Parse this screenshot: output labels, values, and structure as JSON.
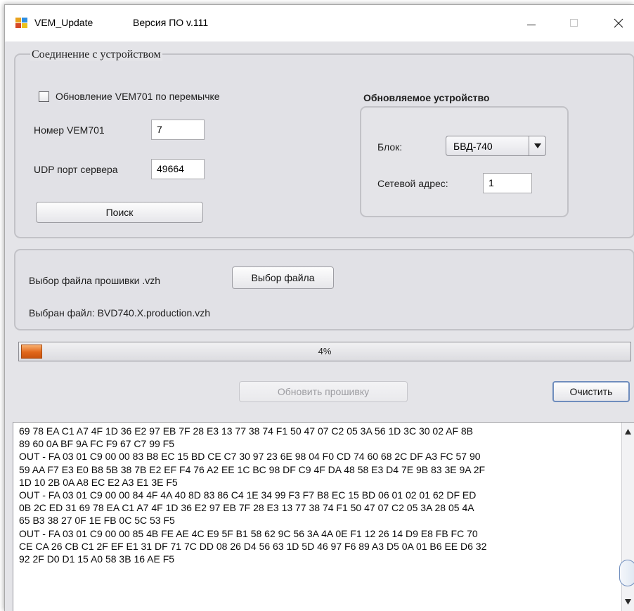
{
  "window": {
    "app_name": "VEM_Update",
    "version_label": "Версия ПО v.111",
    "icon_colors": [
      "#e8a21d",
      "#2f8ee0",
      "#d64826",
      "#ecc21e"
    ]
  },
  "connection": {
    "group_title": "Соединение с устройством",
    "jumper_update_label": "Обновление VEM701 по перемычке",
    "jumper_update_checked": false,
    "vem_number_label": "Номер VEM701",
    "vem_number_value": "7",
    "udp_port_label": "UDP порт сервера",
    "udp_port_value": "49664",
    "search_button": "Поиск"
  },
  "device": {
    "group_title": "Обновляемое устройство",
    "block_label": "Блок:",
    "block_value": "БВД-740",
    "network_address_label": "Сетевой адрес:",
    "network_address_value": "1"
  },
  "firmware": {
    "select_label": "Выбор файла прошивки .vzh",
    "select_button": "Выбор файла",
    "selected_text": "Выбран файл: BVD740.X.production.vzh"
  },
  "progress": {
    "value_percent": 4,
    "text": "4%",
    "fill_color": "#e2671a"
  },
  "actions": {
    "update_button": "Обновить прошивку",
    "update_enabled": false,
    "clear_button": "Очистить"
  },
  "log": {
    "text": "69 78 EA C1 A7 4F 1D 36 E2 97 EB 7F 28 E3 13 77 38 74 F1 50 47 07 C2 05 3A 56 1D 3C 30 02 AF 8B\n89 60 0A BF 9A FC F9 67 C7 99 F5\nOUT - FA 03 01 C9 00 00 83 B8 EC 15 BD CE C7 30 97 23 6E 98 04 F0 CD 74 60 68 2C DF A3 FC 57 90\n59 AA F7 E3 E0 B8 5B 38 7B E2 EF F4 76 A2 EE 1C BC 98 DF C9 4F DA 48 58 E3 D4 7E 9B 83 3E 9A 2F\n1D 10 2B 0A A8 EC E2 A3 E1 3E F5\nOUT - FA 03 01 C9 00 00 84 4F 4A 40 8D 83 86 C4 1E 34 99 F3 F7 B8 EC 15 BD 06 01 02 01 62 DF ED\n0B 2C ED 31 69 78 EA C1 A7 4F 1D 36 E2 97 EB 7F 28 E3 13 77 38 74 F1 50 47 07 C2 05 3A 28 05 4A\n65 B3 38 27 0F 1E FB 0C 5C 53 F5\nOUT - FA 03 01 C9 00 00 85 4B FE AE 4C E9 5F B1 58 62 9C 56 3A 4A 0E F1 12 26 14 D9 E8 FB FC 70\nCE CA 26 CB C1 2F EF E1 31 DF 71 7C DD 08 26 D4 56 63 1D 5D 46 97 F6 89 A3 D5 0A 01 B6 EE D6 32\n92 2F D0 D1 15 A0 58 3B 16 AE F5"
  }
}
